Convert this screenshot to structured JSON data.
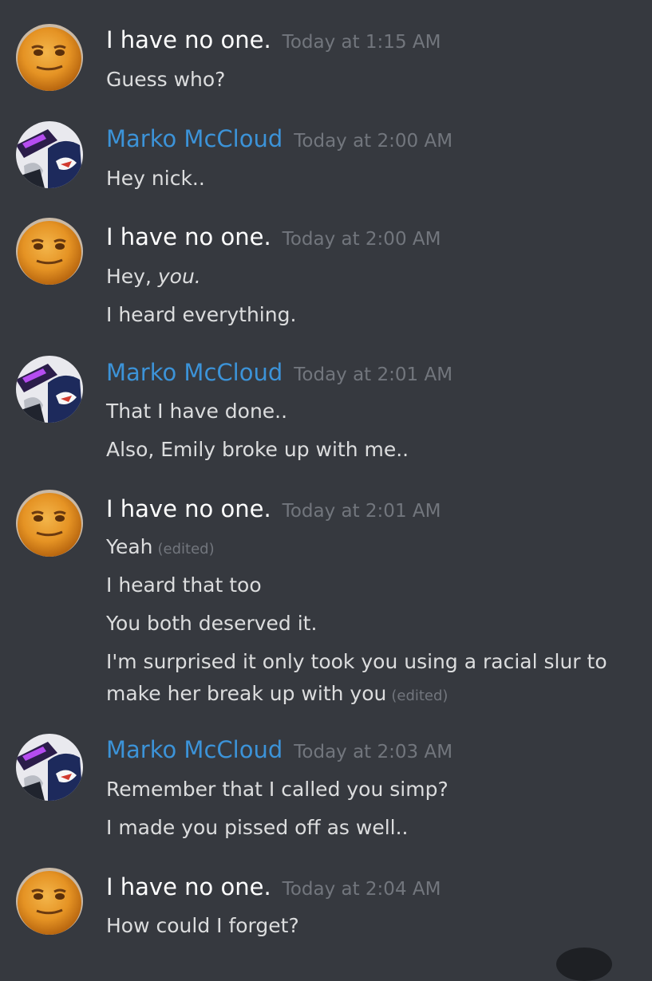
{
  "messages": [
    {
      "username": "I have no one.",
      "timestamp": "Today at 1:15 AM",
      "lines": [
        "Guess who?"
      ]
    },
    {
      "username": "Marko McCloud",
      "timestamp": "Today at 2:00 AM",
      "lines": [
        "Hey nick.."
      ]
    },
    {
      "username": "I have no one.",
      "timestamp": "Today at 2:00 AM",
      "lines": [
        "Hey,",
        "you.",
        "I heard everything."
      ]
    },
    {
      "username": "Marko McCloud",
      "timestamp": "Today at 2:01 AM",
      "lines": [
        "That I have done..",
        "Also, Emily broke up with me.."
      ]
    },
    {
      "username": "I have no one.",
      "timestamp": "Today at 2:01 AM",
      "lines": [
        "Yeah",
        "I heard that too",
        "You both deserved it.",
        "I'm surprised it only took you using a racial slur to make her break up with you"
      ]
    },
    {
      "username": "Marko McCloud",
      "timestamp": "Today at 2:03 AM",
      "lines": [
        "Remember that I called you simp?",
        "I made you pissed off as well.."
      ]
    },
    {
      "username": "I have no one.",
      "timestamp": "Today at 2:04 AM",
      "lines": [
        "How could I forget?"
      ]
    }
  ],
  "edited_label": "(edited)",
  "colors": {
    "background": "#36393f",
    "username_default": "#ffffff",
    "username_marko": "#3c93d8",
    "message_text": "#dcddde",
    "timestamp": "#72767d"
  },
  "icons": {
    "orange": "annoying-orange-avatar",
    "marko": "character-artwork-avatar"
  }
}
